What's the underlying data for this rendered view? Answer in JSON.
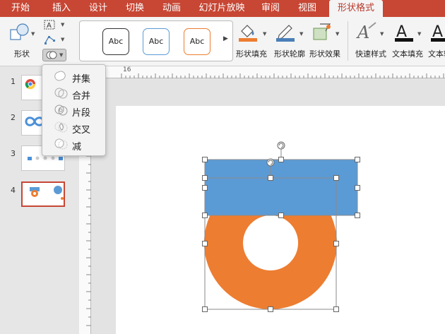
{
  "tabs": [
    {
      "label": "开始"
    },
    {
      "label": "插入"
    },
    {
      "label": "设计"
    },
    {
      "label": "切换"
    },
    {
      "label": "动画"
    },
    {
      "label": "幻灯片放映"
    },
    {
      "label": "审阅"
    },
    {
      "label": "视图"
    },
    {
      "label": "形状格式",
      "active": true
    }
  ],
  "ribbon": {
    "shape_label": "形状",
    "styles": [
      {
        "label": "Abc",
        "color": "#333333"
      },
      {
        "label": "Abc",
        "color": "#5b9bd5"
      },
      {
        "label": "Abc",
        "color": "#ed7d31"
      }
    ],
    "fill_label": "形状填充",
    "outline_label": "形状轮廓",
    "effects_label": "形状效果",
    "quick_styles_label": "快速样式",
    "text_fill_label": "文本填充",
    "text_outline_label": "文本轮"
  },
  "merge_menu": {
    "items": [
      {
        "label": "并集",
        "icon": "union-icon"
      },
      {
        "label": "合并",
        "icon": "combine-icon"
      },
      {
        "label": "片段",
        "icon": "fragment-icon"
      },
      {
        "label": "交叉",
        "icon": "intersect-icon"
      },
      {
        "label": "减",
        "icon": "subtract-icon"
      }
    ]
  },
  "slides": [
    {
      "number": "1"
    },
    {
      "number": "2"
    },
    {
      "number": "3"
    },
    {
      "number": "4",
      "selected": true
    }
  ],
  "ruler_top_label": "16",
  "colors": {
    "accent": "#c74634",
    "blue_shape": "#5b9bd5",
    "orange_shape": "#ed7d31"
  }
}
